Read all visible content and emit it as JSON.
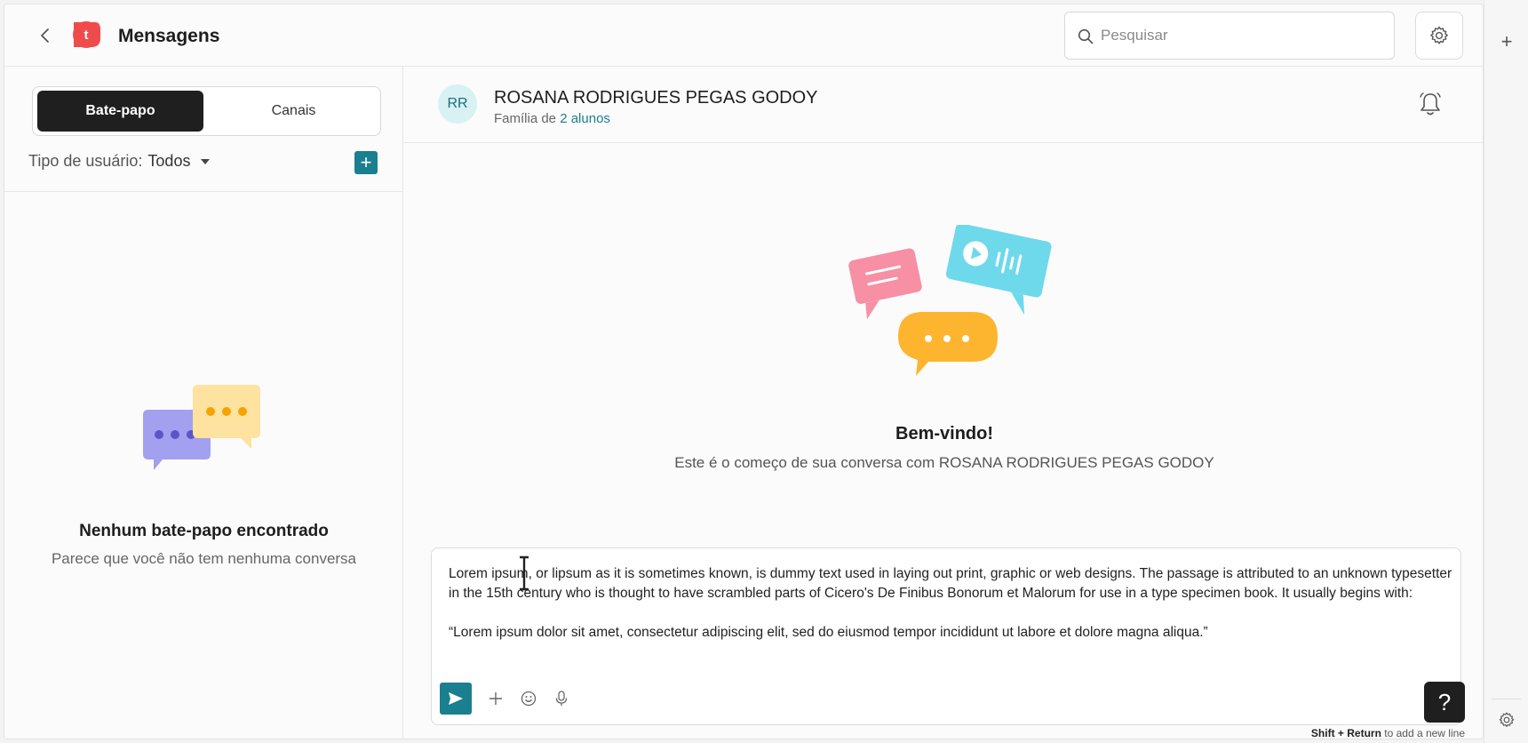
{
  "header": {
    "title": "Mensagens",
    "logo_letter": "t",
    "search_placeholder": "Pesquisar"
  },
  "sidebar": {
    "tabs": [
      {
        "label": "Bate-papo",
        "active": true
      },
      {
        "label": "Canais",
        "active": false
      }
    ],
    "filter_label": "Tipo de usuário:",
    "filter_value": "Todos",
    "add_button": "+",
    "empty_title": "Nenhum bate-papo encontrado",
    "empty_subtitle": "Parece que você não tem nenhuma conversa"
  },
  "conversation": {
    "avatar_initials": "RR",
    "contact_name": "ROSANA RODRIGUES PEGAS GODOY",
    "subtitle_prefix": "Família de",
    "subtitle_link": "2 alunos",
    "welcome_title": "Bem-vindo!",
    "welcome_subtitle": "Este é o começo de sua conversa com ROSANA RODRIGUES PEGAS GODOY"
  },
  "composer": {
    "paragraph1": "Lorem ipsum, or lipsum as it is sometimes known, is dummy text used in laying out print, graphic or web designs. The passage is attributed to an unknown typesetter in the 15th century who is thought to have scrambled parts of Cicero's De Finibus Bonorum et Malorum for use in a type specimen book. It usually begins with:",
    "paragraph2": "“Lorem ipsum dolor sit amet, consectetur adipiscing elit, sed do eiusmod tempor incididunt ut labore et dolore magna aliqua.”",
    "hint_keys": "Shift + Return",
    "hint_text": " to add a new line"
  },
  "help_button": "?",
  "colors": {
    "accent": "#1a7f8e",
    "logo": "#ef4b4b",
    "dark": "#1f1f1f"
  }
}
